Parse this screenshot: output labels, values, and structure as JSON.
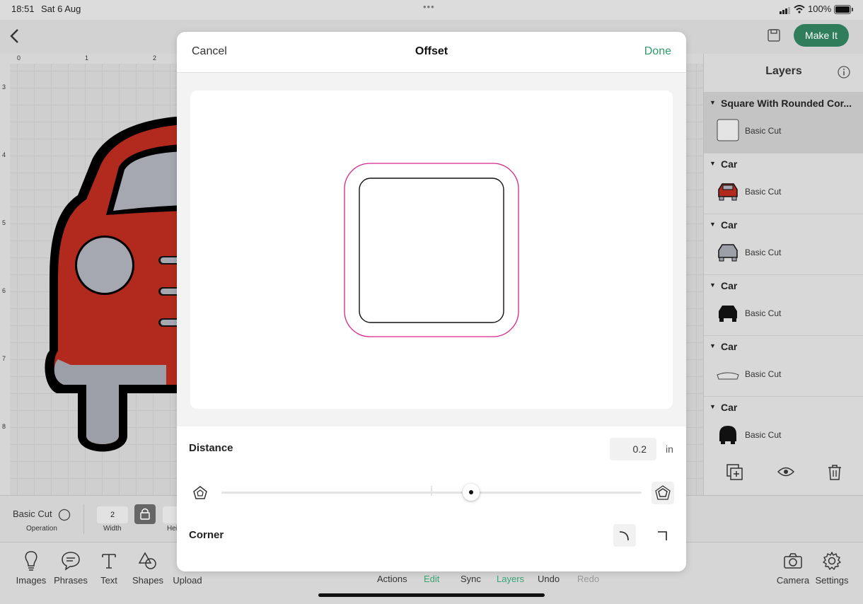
{
  "status": {
    "time": "18:51",
    "date": "Sat 6 Aug",
    "battery": "100%"
  },
  "topbar": {
    "make_it": "Make It"
  },
  "ruler": {
    "top": [
      "0",
      "1",
      "2"
    ],
    "left": [
      "3",
      "4",
      "5",
      "6",
      "7",
      "8"
    ]
  },
  "layers": {
    "title": "Layers",
    "groups": [
      {
        "name": "Square With Rounded Cor...",
        "op": "Basic Cut"
      },
      {
        "name": "Car",
        "op": "Basic Cut"
      },
      {
        "name": "Car",
        "op": "Basic Cut"
      },
      {
        "name": "Car",
        "op": "Basic Cut"
      },
      {
        "name": "Car",
        "op": "Basic Cut"
      },
      {
        "name": "Car",
        "op": "Basic Cut"
      }
    ]
  },
  "editbar": {
    "operation_value": "Basic Cut",
    "operation_label": "Operation",
    "width_value": "2",
    "width_label": "Width",
    "height_label_partial": "Hei"
  },
  "tabs": {
    "images": "Images",
    "phrases": "Phrases",
    "text": "Text",
    "shapes": "Shapes",
    "upload": "Upload",
    "camera": "Camera",
    "settings": "Settings"
  },
  "bottom_tabs": {
    "actions": "Actions",
    "edit": "Edit",
    "sync": "Sync",
    "layers": "Layers",
    "undo": "Undo",
    "redo": "Redo"
  },
  "modal": {
    "cancel": "Cancel",
    "title": "Offset",
    "done": "Done",
    "distance_label": "Distance",
    "distance_value": "0.2",
    "distance_unit": "in",
    "slider_fraction": 0.595,
    "corner_label": "Corner"
  },
  "colors": {
    "accent_green": "#2f7d5b",
    "offset_stroke": "#d6248a",
    "car_red": "#b22a1e"
  }
}
